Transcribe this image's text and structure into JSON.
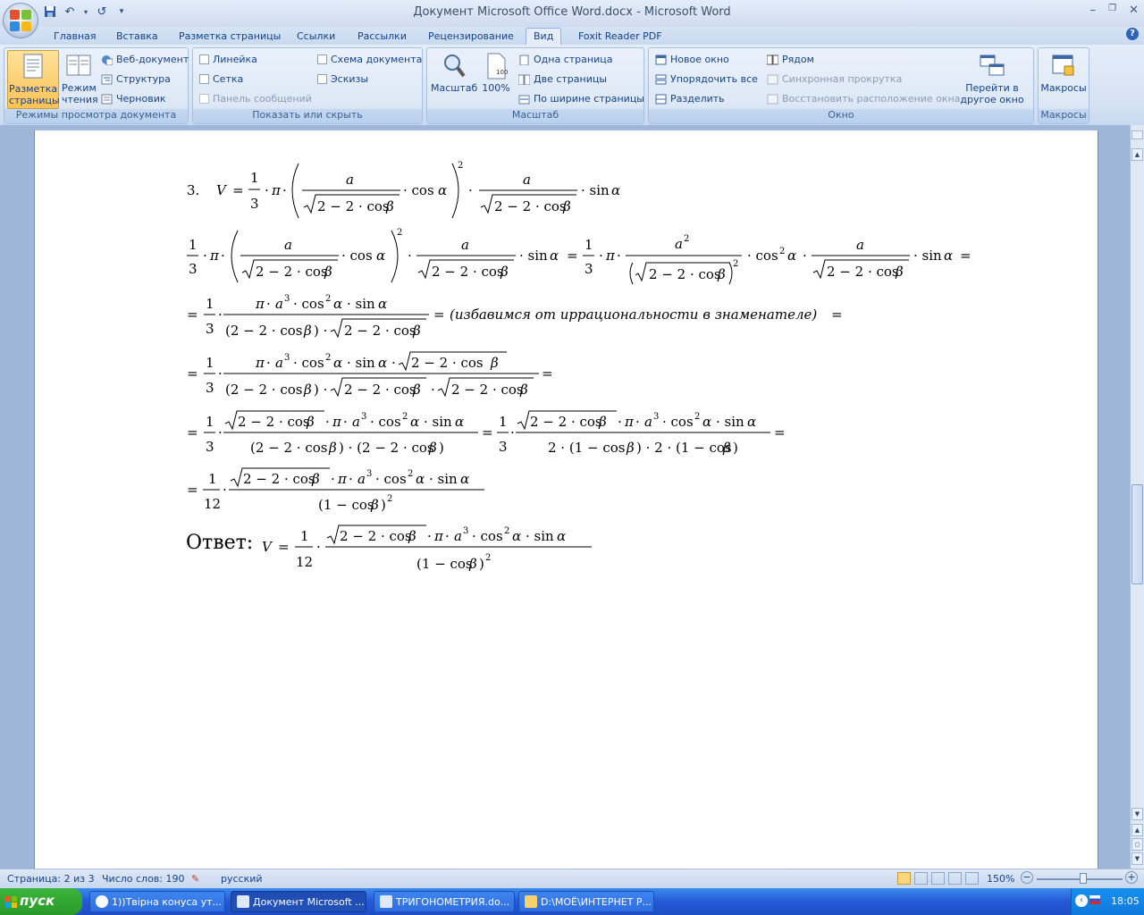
{
  "window": {
    "title": "Документ Microsoft Office Word.docx - Microsoft Word",
    "controls": [
      "–",
      "❐",
      "✕"
    ]
  },
  "quick_access": {
    "save": "save-icon",
    "undo": "undo-icon",
    "redo": "redo-icon",
    "customize": "▾"
  },
  "tabs": [
    "Главная",
    "Вставка",
    "Разметка страницы",
    "Ссылки",
    "Рассылки",
    "Рецензирование",
    "Вид",
    "Foxit Reader PDF"
  ],
  "active_tab": "Вид",
  "ribbon": {
    "views": {
      "label": "Режимы просмотра документа",
      "print_layout": "Разметка страницы",
      "reading": "Режим чтения",
      "web": "Веб-документ",
      "outline": "Структура",
      "draft": "Черновик"
    },
    "showhide": {
      "label": "Показать или скрыть",
      "ruler": "Линейка",
      "gridlines": "Сетка",
      "message_bar": "Панель сообщений",
      "doc_map": "Схема документа",
      "thumbnails": "Эскизы"
    },
    "zoom": {
      "label": "Масштаб",
      "zoom": "Масштаб",
      "hundred": "100%",
      "one_page": "Одна страница",
      "two_pages": "Две страницы",
      "page_width": "По ширине страницы"
    },
    "window": {
      "label": "Окно",
      "new_window": "Новое окно",
      "arrange_all": "Упорядочить все",
      "split": "Разделить",
      "side_by_side": "Рядом",
      "sync_scroll": "Синхронная прокрутка",
      "reset_pos": "Восстановить расположение окна",
      "switch_windows": "Перейти в другое окно"
    },
    "macros": {
      "label": "Макросы",
      "macros": "Макросы"
    }
  },
  "document": {
    "item_number": "3.",
    "irrational_note": "(избавимся от иррациональности в знаменателе)",
    "answer_label": "Ответ:"
  },
  "status": {
    "page": "Страница: 2 из 3",
    "words": "Число слов: 190",
    "language": "русский",
    "zoom": "150%"
  },
  "taskbar": {
    "start": "пуск",
    "buttons": [
      "1))Твірна конуса ут...",
      "Документ Microsoft ...",
      "ТРИГОНОМЕТРИЯ.do...",
      "D:\\МОЁ\\ИНТЕРНЕТ Р..."
    ],
    "clock": "18:05"
  }
}
